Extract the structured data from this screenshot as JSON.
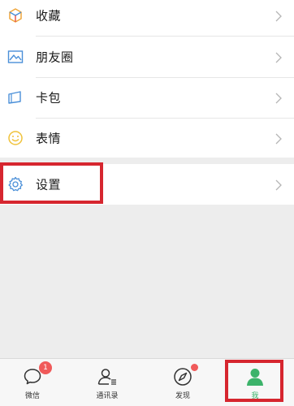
{
  "menu": {
    "items": [
      {
        "label": "收藏",
        "icon": "cube-icon"
      },
      {
        "label": "朋友圈",
        "icon": "photo-icon"
      },
      {
        "label": "卡包",
        "icon": "card-wallet-icon"
      },
      {
        "label": "表情",
        "icon": "smiley-icon"
      }
    ],
    "settings": {
      "label": "设置",
      "icon": "gear-icon"
    }
  },
  "tabbar": {
    "tabs": [
      {
        "label": "微信",
        "icon": "chat-bubble-icon",
        "badge": "1"
      },
      {
        "label": "通讯录",
        "icon": "contacts-icon"
      },
      {
        "label": "发现",
        "icon": "compass-icon"
      },
      {
        "label": "我",
        "icon": "person-icon"
      }
    ],
    "active_index": 3
  },
  "colors": {
    "accent_green": "#3cb36a",
    "highlight_red": "#d6262f",
    "badge_red": "#f05a5a",
    "icon_blue": "#4a8fd8"
  }
}
